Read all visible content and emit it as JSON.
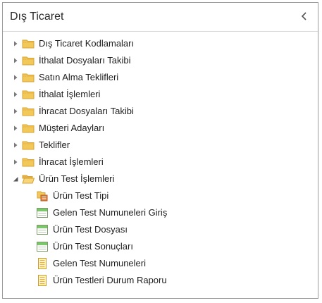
{
  "panel": {
    "title": "Dış Ticaret",
    "collapse_icon": "chevron-left-icon"
  },
  "tree": {
    "folders": [
      {
        "label": "Dış Ticaret Kodlamaları",
        "expanded": false,
        "icon": "folder-icon"
      },
      {
        "label": "İthalat Dosyaları Takibi",
        "expanded": false,
        "icon": "folder-icon"
      },
      {
        "label": "Satın Alma Teklifleri",
        "expanded": false,
        "icon": "folder-icon"
      },
      {
        "label": "İthalat İşlemleri",
        "expanded": false,
        "icon": "folder-icon"
      },
      {
        "label": "İhracat Dosyaları Takibi",
        "expanded": false,
        "icon": "folder-icon"
      },
      {
        "label": "Müşteri Adayları",
        "expanded": false,
        "icon": "folder-icon"
      },
      {
        "label": "Teklifler",
        "expanded": false,
        "icon": "folder-icon"
      },
      {
        "label": "İhracat İşlemleri",
        "expanded": false,
        "icon": "folder-icon"
      },
      {
        "label": "Ürün Test İşlemleri",
        "expanded": true,
        "icon": "folder-open-icon"
      }
    ],
    "children": [
      {
        "label": "Ürün Test Tipi",
        "icon": "definition-icon"
      },
      {
        "label": "Gelen Test Numuneleri Giriş",
        "icon": "form-icon"
      },
      {
        "label": "Ürün Test Dosyası",
        "icon": "form-icon"
      },
      {
        "label": "Ürün Test Sonuçları",
        "icon": "form-icon"
      },
      {
        "label": "Gelen Test Numuneleri",
        "icon": "report-icon"
      },
      {
        "label": "Ürün Testleri Durum Raporu",
        "icon": "report-icon"
      }
    ]
  },
  "colors": {
    "folder": "#f3c85b",
    "folder_dark": "#d9a22e",
    "form_header": "#7cc66b",
    "report": "#f0b429",
    "border": "#9a9a9a"
  }
}
